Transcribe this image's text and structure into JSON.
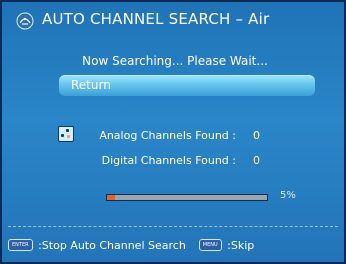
{
  "header": {
    "title": "AUTO CHANNEL SEARCH – Air"
  },
  "status": {
    "message": "Now Searching... Please Wait..."
  },
  "actions": {
    "return_label": "Return"
  },
  "results": {
    "analog_label": "Analog Channels Found :",
    "analog_count": "0",
    "digital_label": "Digital Channels Found :",
    "digital_count": "0"
  },
  "progress": {
    "percent": 5,
    "percent_label": "5%"
  },
  "hints": [
    {
      "key": "ENTER",
      "text": ":Stop Auto Channel Search"
    },
    {
      "key": "MENU",
      "text": ":Skip"
    }
  ],
  "colors": {
    "panel_blue": "#2a86c8",
    "button_cyan": "#67c5ee",
    "progress_fill": "#e1642f",
    "progress_track": "#9aa5ad"
  },
  "icons": {
    "title_icon": "satellite-dish-icon",
    "scan_icon": "scan-icon"
  }
}
